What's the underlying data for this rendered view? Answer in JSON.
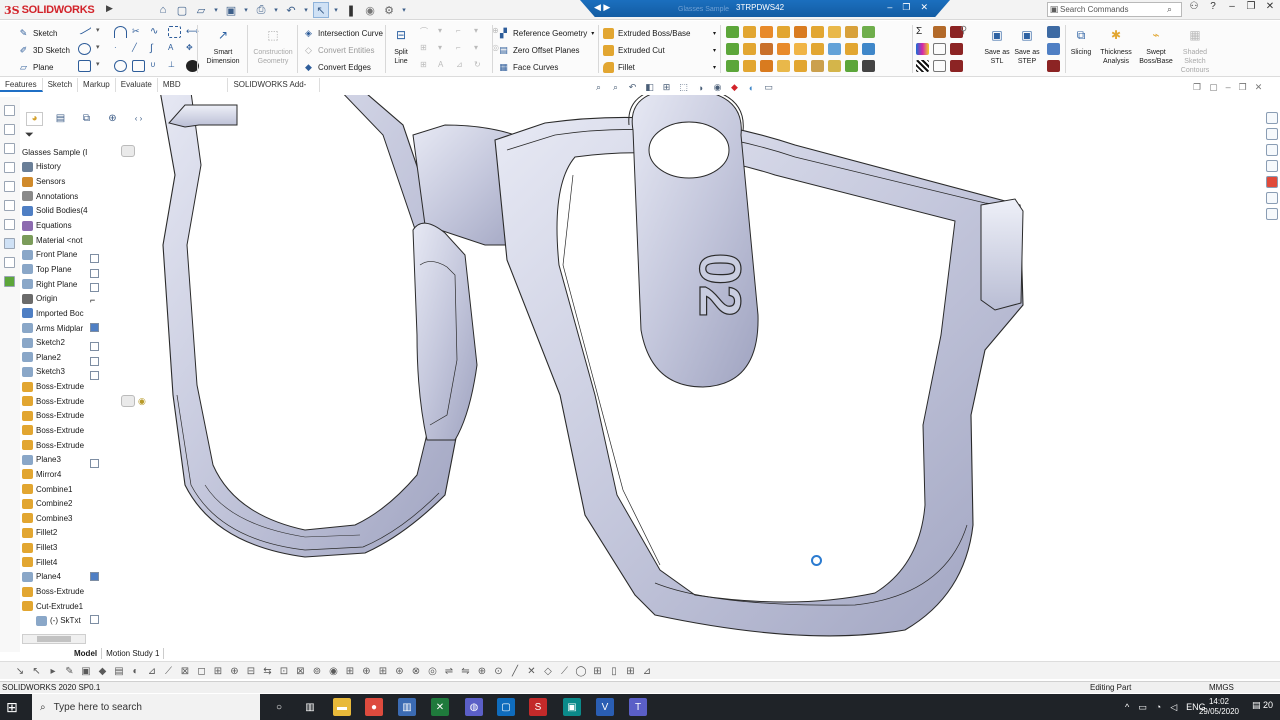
{
  "app": {
    "logo_prefix": "3S",
    "logo_name": "SOLIDWORKS"
  },
  "title_bar": {
    "ghost_label": "Glasses Sample",
    "document_name": "3TRPDWS42",
    "search_placeholder": "Search Commands"
  },
  "command_manager": {
    "sketch_group": [
      "Sketch",
      "3D Sketch",
      "Plane"
    ],
    "big_buttons": [
      {
        "label": "Smart Dimension",
        "icon": "smart-dimension-icon"
      },
      {
        "label": "Construction Geometry",
        "icon": "construction-geometry-icon"
      },
      {
        "label": "Split Line",
        "icon": "split-line-icon"
      },
      {
        "label": "Save as STL",
        "icon": "save-stl-icon"
      },
      {
        "label": "Save as STEP",
        "icon": "save-step-icon"
      },
      {
        "label": "Slicing",
        "icon": "slicing-icon"
      },
      {
        "label": "Thickness Analysis",
        "icon": "thickness-analysis-icon"
      },
      {
        "label": "Swept Boss/Base",
        "icon": "swept-boss-icon"
      },
      {
        "label": "Shaded Sketch Contours",
        "icon": "shaded-sketch-contours-icon"
      }
    ],
    "curve_items": [
      "Intersection Curve",
      "Convert Entities",
      "Convert Edges"
    ],
    "ref_items": [
      "Reference Geometry",
      "Zero Offset Planes",
      "Face Curves"
    ],
    "feature_items": [
      "Extruded Boss/Base",
      "Extruded Cut",
      "Fillet"
    ]
  },
  "tabs": [
    "Features",
    "Sketch",
    "Markup",
    "Evaluate",
    "MBD Dimensions",
    "SOLIDWORKS Add-Ins"
  ],
  "feature_tree": {
    "root": "Glasses Sample (I",
    "nodes": [
      {
        "label": "History",
        "icon": "history-icon",
        "color": "#6a7f98"
      },
      {
        "label": "Sensors",
        "icon": "sensors-icon",
        "color": "#d08a2b"
      },
      {
        "label": "Annotations",
        "icon": "annotations-icon",
        "color": "#8a8a8a"
      },
      {
        "label": "Solid Bodies(4",
        "icon": "solid-bodies-icon",
        "color": "#4f7fc4"
      },
      {
        "label": "Equations",
        "icon": "equations-icon",
        "color": "#8d6bb0"
      },
      {
        "label": "Material <not",
        "icon": "material-icon",
        "color": "#7b9c5a"
      },
      {
        "label": "Front Plane",
        "icon": "plane-icon",
        "color": "#8aa7c8"
      },
      {
        "label": "Top Plane",
        "icon": "plane-icon",
        "color": "#8aa7c8"
      },
      {
        "label": "Right Plane",
        "icon": "plane-icon",
        "color": "#8aa7c8"
      },
      {
        "label": "Origin",
        "icon": "origin-icon",
        "color": "#6b6b6b"
      },
      {
        "label": "Imported Boc",
        "icon": "imported-body-icon",
        "color": "#4f7fc4"
      },
      {
        "label": "Arms Midplar",
        "icon": "plane-icon",
        "color": "#8aa7c8"
      },
      {
        "label": "Sketch2",
        "icon": "sketch-icon",
        "color": "#8aa7c8"
      },
      {
        "label": "Plane2",
        "icon": "plane-icon",
        "color": "#8aa7c8"
      },
      {
        "label": "Sketch3",
        "icon": "sketch-icon",
        "color": "#8aa7c8"
      },
      {
        "label": "Boss-Extrude",
        "icon": "boss-extrude-icon",
        "color": "#e2a631"
      },
      {
        "label": "Boss-Extrude",
        "icon": "boss-extrude-icon",
        "color": "#e2a631"
      },
      {
        "label": "Boss-Extrude",
        "icon": "boss-extrude-icon",
        "color": "#e2a631"
      },
      {
        "label": "Boss-Extrude",
        "icon": "boss-extrude-icon",
        "color": "#e2a631"
      },
      {
        "label": "Boss-Extrude",
        "icon": "boss-extrude-icon",
        "color": "#e2a631"
      },
      {
        "label": "Plane3",
        "icon": "plane-icon",
        "color": "#8aa7c8"
      },
      {
        "label": "Mirror4",
        "icon": "mirror-icon",
        "color": "#e2a631"
      },
      {
        "label": "Combine1",
        "icon": "combine-icon",
        "color": "#e2a631"
      },
      {
        "label": "Combine2",
        "icon": "combine-icon",
        "color": "#e2a631"
      },
      {
        "label": "Combine3",
        "icon": "combine-icon",
        "color": "#e2a631"
      },
      {
        "label": "Fillet2",
        "icon": "fillet-icon",
        "color": "#e2a631"
      },
      {
        "label": "Fillet3",
        "icon": "fillet-icon",
        "color": "#e2a631"
      },
      {
        "label": "Fillet4",
        "icon": "fillet-icon",
        "color": "#e2a631"
      },
      {
        "label": "Plane4",
        "icon": "plane-icon",
        "color": "#8aa7c8"
      },
      {
        "label": "Boss-Extrude",
        "icon": "boss-extrude-icon",
        "color": "#e2a631"
      },
      {
        "label": "Cut-Extrude1",
        "icon": "cut-extrude-icon",
        "color": "#e2a631"
      },
      {
        "label": "(-) SkTxt",
        "icon": "sketch-text-icon",
        "color": "#8aa7c8",
        "child": true
      }
    ]
  },
  "viewport": {
    "tag_text": "02",
    "part_color": "#cfd2e6"
  },
  "bottom_tabs": [
    "Model",
    "Motion Study 1"
  ],
  "status": {
    "left": "SOLIDWORKS 2020 SP0.1",
    "mode": "Editing Part",
    "units": "MMGS"
  },
  "taskbar": {
    "search_placeholder": "Type here to search",
    "lang": "ENG",
    "time": "14:02",
    "date": "29/05/2020",
    "notifications": "20",
    "apps": [
      "cortana",
      "task-view",
      "file-explorer",
      "chrome",
      "solidworks-explorer",
      "excel",
      "teams-classic",
      "outlook",
      "solidworks",
      "vpn",
      "visio",
      "teams"
    ]
  },
  "colors": {
    "accent": "#1b6fbe",
    "brand_red": "#d2232a",
    "feature_orange": "#e2a631"
  }
}
